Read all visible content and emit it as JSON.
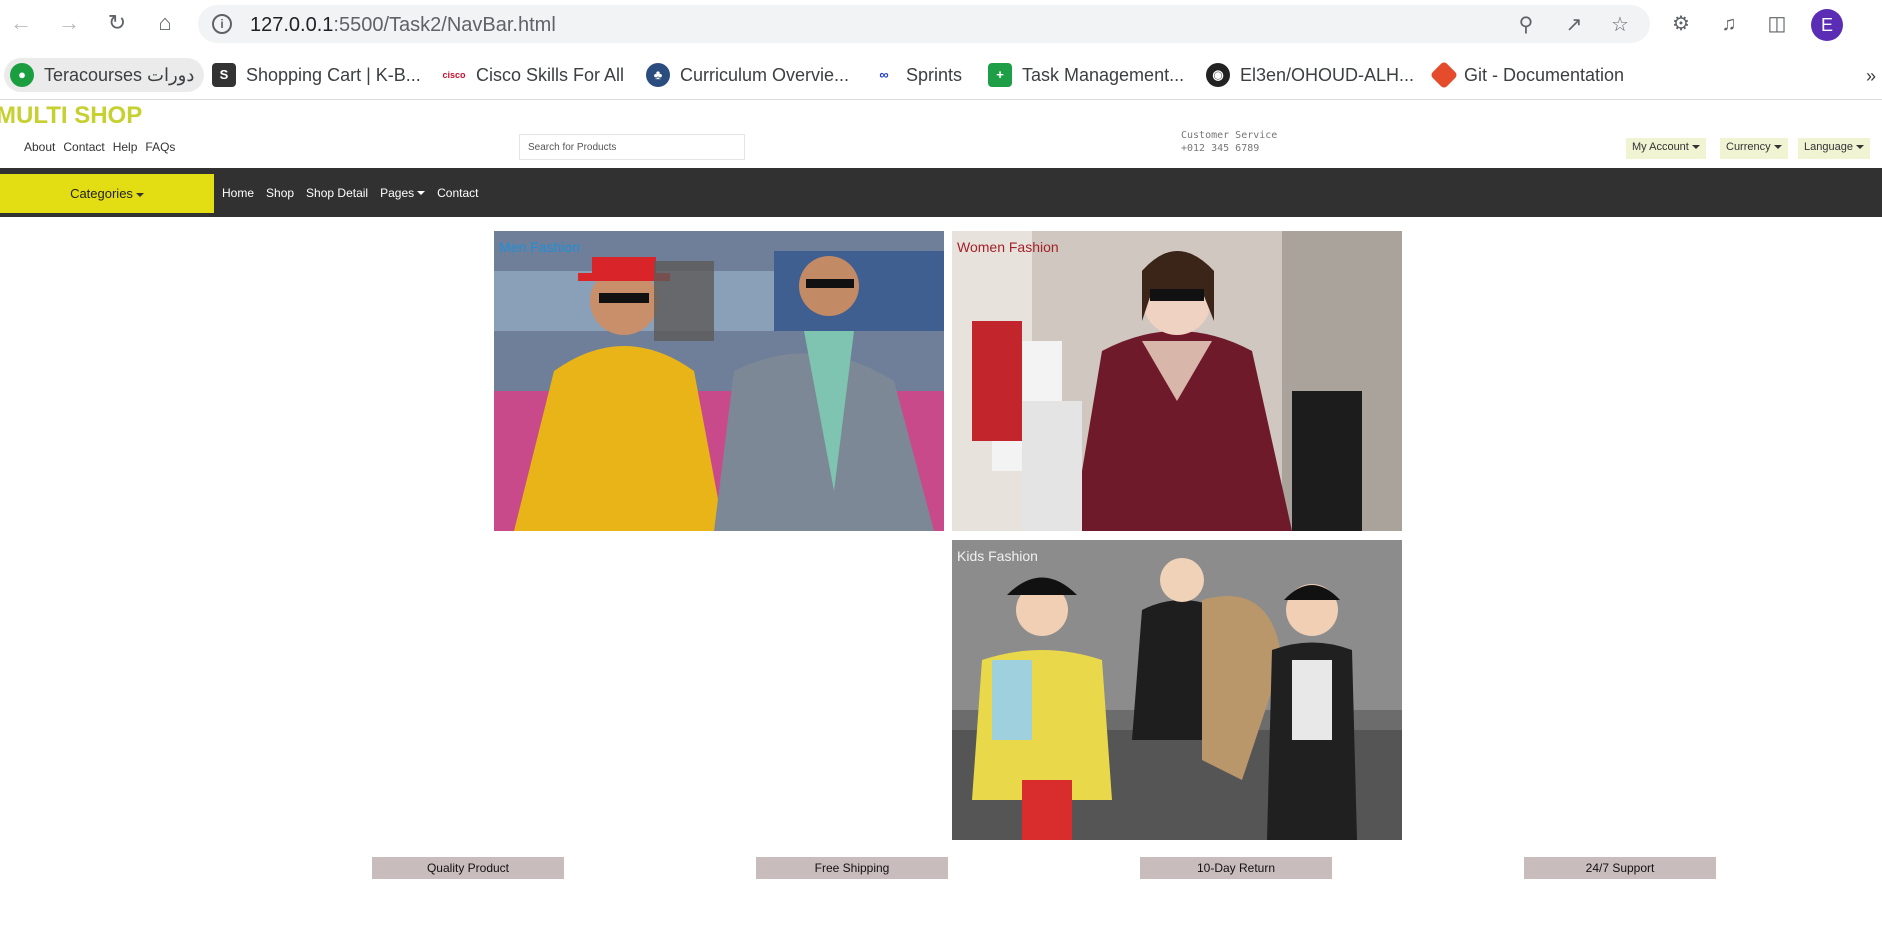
{
  "browser": {
    "url_host": "127.0.0.1",
    "url_path": ":5500/Task2/NavBar.html",
    "profile_initial": "E",
    "icons": [
      "back-icon",
      "forward-icon",
      "reload-icon",
      "home-icon",
      "site-info-icon",
      "zoom-icon",
      "share-icon",
      "bookmark-star-icon",
      "extensions-icon",
      "media-icon",
      "side-panel-icon"
    ],
    "bookmarks": [
      {
        "label": "Teracourses دورات",
        "color": "#1a9e3f"
      },
      {
        "label": "Shopping Cart | K-B...",
        "color": "#333333"
      },
      {
        "label": "Cisco Skills For All",
        "color": "#c8102e"
      },
      {
        "label": "Curriculum Overvie...",
        "color": "#2b4c7e"
      },
      {
        "label": "Sprints",
        "color": "#1f3bd6"
      },
      {
        "label": "Task Management...",
        "color": "#1e9e47"
      },
      {
        "label": "El3en/OHOUD-ALH...",
        "color": "#222222"
      },
      {
        "label": "Git - Documentation",
        "color": "#e44c2c"
      }
    ],
    "more_label": "»"
  },
  "site": {
    "logo": "MULTI SHOP",
    "logo_color": "#c6d02f",
    "top_links": [
      "About",
      "Contact",
      "Help",
      "FAQs"
    ],
    "search_placeholder": "Search for Products",
    "customer_service": {
      "title": "Customer Service",
      "phone": "+012 345 6789"
    },
    "dropdowns": [
      "My Account",
      "Currency",
      "Language"
    ],
    "categories_label": "Categories",
    "nav_links": [
      "Home",
      "Shop",
      "Shop Detail",
      "Pages",
      "Contact"
    ],
    "tiles": [
      {
        "label": "Men Fashion",
        "label_color": "#1e8fd8"
      },
      {
        "label": "Women Fashion",
        "label_color": "#a3222a"
      },
      {
        "label": "Kids Fashion",
        "label_color": "#f0f0f0"
      }
    ],
    "features": [
      "Quality Product",
      "Free Shipping",
      "10-Day Return",
      "24/7 Support"
    ]
  }
}
